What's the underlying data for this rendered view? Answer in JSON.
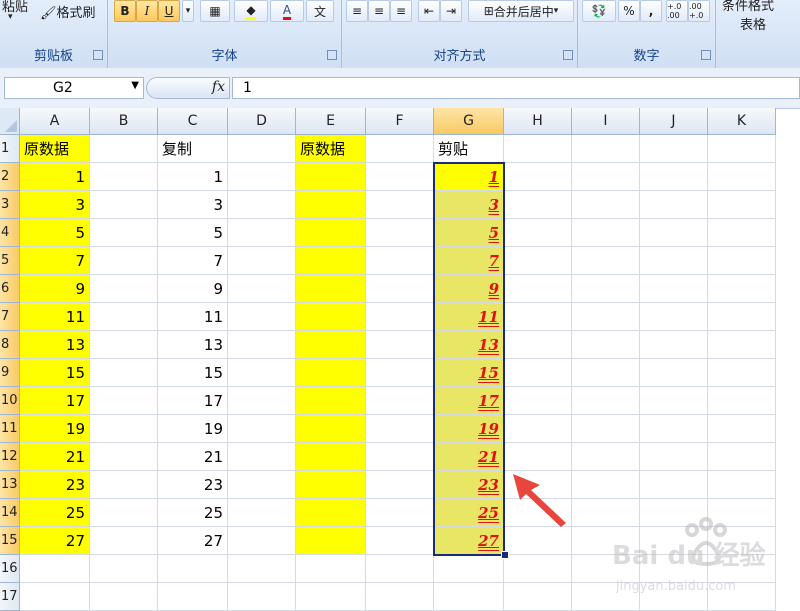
{
  "ribbon": {
    "clipboard": {
      "label": "剪贴板",
      "paste_label": "粘贴",
      "format_painter_label": "格式刷"
    },
    "font": {
      "label": "字体",
      "bold": "B",
      "italic": "I",
      "underline": "U",
      "font_color_glyph": "A",
      "phonetic_glyph": "文"
    },
    "alignment": {
      "label": "对齐方式",
      "merge_label": "合并后居中"
    },
    "number": {
      "label": "数字",
      "percent": "%",
      "comma": ",",
      "inc_decimal": "+.0 .00",
      "dec_decimal": ".00 +.0"
    },
    "styles": {
      "conditional_label": "条件格式",
      "table_label": "表格"
    },
    "accent_color": "#15428b",
    "font_color_swatch": "#e01010",
    "highlight_swatch": "#ffff00"
  },
  "formula_bar": {
    "name_box": "G2",
    "fx_label": "fx",
    "value": "1"
  },
  "columns": [
    "A",
    "B",
    "C",
    "D",
    "E",
    "F",
    "G",
    "H",
    "I",
    "J",
    "K"
  ],
  "rows": [
    "1",
    "2",
    "3",
    "4",
    "5",
    "6",
    "7",
    "8",
    "9",
    "10",
    "11",
    "12",
    "13",
    "14",
    "15",
    "16",
    "17"
  ],
  "selected_column": "G",
  "headers": {
    "A": "原数据",
    "C": "复制",
    "E": "原数据",
    "G": "剪贴"
  },
  "col_a": [
    "1",
    "3",
    "5",
    "7",
    "9",
    "11",
    "13",
    "15",
    "17",
    "19",
    "21",
    "23",
    "25",
    "27"
  ],
  "col_c": [
    "1",
    "3",
    "5",
    "7",
    "9",
    "11",
    "13",
    "15",
    "17",
    "19",
    "21",
    "23",
    "25",
    "27"
  ],
  "col_g": [
    "1",
    "3",
    "5",
    "7",
    "9",
    "11",
    "13",
    "15",
    "17",
    "19",
    "21",
    "23",
    "25",
    "27"
  ],
  "colors": {
    "yellow_fill": "#ffff00",
    "pasted_fill": "#e9e666",
    "pasted_text": "#e01010",
    "selection": "#1b2b7c",
    "arrow": "#e8453c"
  },
  "watermark": {
    "brand": "Bai du 经验",
    "url": "jingyan.baidu.com"
  }
}
